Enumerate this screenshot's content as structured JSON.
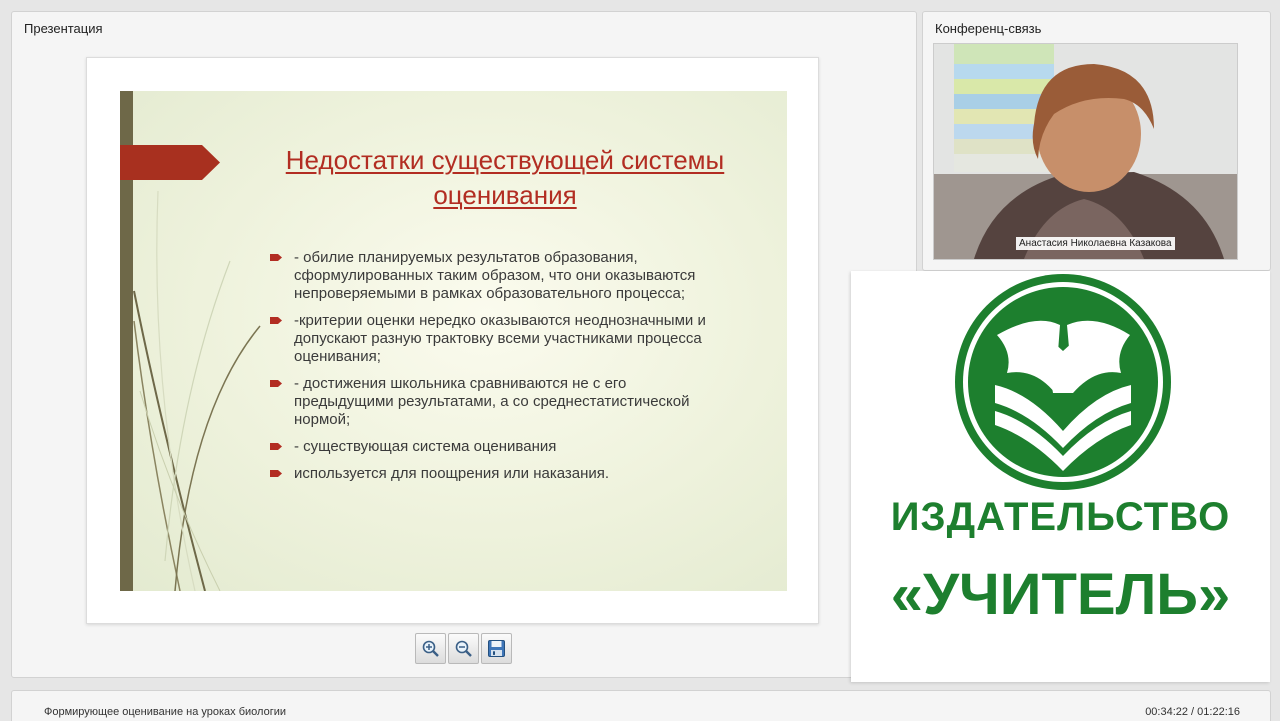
{
  "presentation_panel": {
    "title": "Презентация"
  },
  "slide": {
    "title": "Недостатки существующей системы оценивания",
    "bullets": [
      "- обилие планируемых результатов образования, сформулированных таким образом, что они оказываются непроверяемыми в рамках образовательного процесса;",
      "-критерии оценки нередко оказываются неоднозначными и  допускают разную трактовку всеми участниками процесса оценивания;",
      "- достижения школьника сравниваются не с его предыдущими результатами, а со среднестатистической нормой;",
      "- существующая система оценивания",
      "используется для поощрения или наказания."
    ],
    "accent_color": "#b22d22"
  },
  "toolbar": {
    "icons": [
      "zoom-in-icon",
      "zoom-out-icon",
      "save-icon"
    ]
  },
  "conference_panel": {
    "title": "Конференц-связь",
    "speaker_name": "Анастасия Николаевна Казакова"
  },
  "logo": {
    "line1": "ИЗДАТЕЛЬСТВО",
    "line2": "«УЧИТЕЛЬ»",
    "color": "#1d7f2e"
  },
  "footer": {
    "lecture_title": "Формирующее оценивание на уроках биологии",
    "time": "00:34:22 / 01:22:16"
  }
}
